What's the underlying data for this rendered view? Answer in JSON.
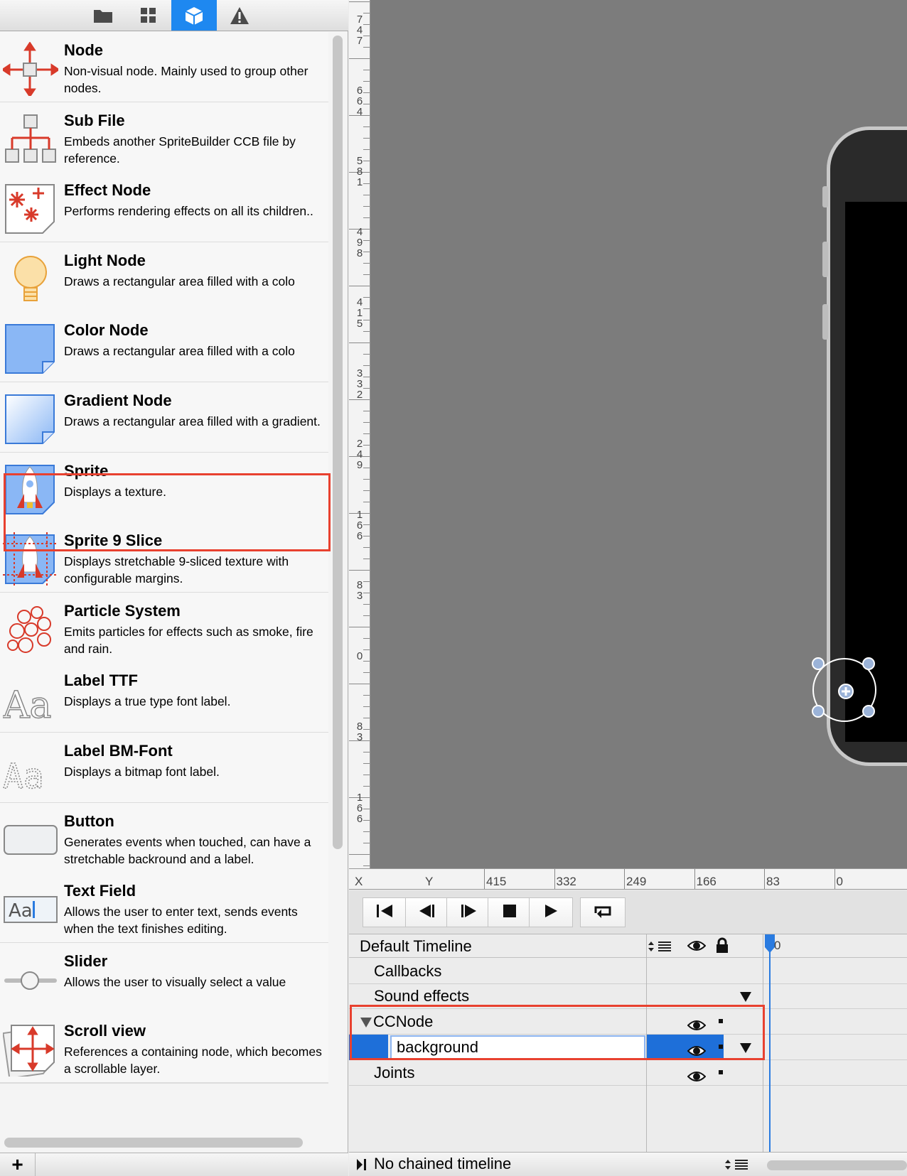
{
  "tabs": [
    {
      "name": "folder-icon",
      "active": false
    },
    {
      "name": "grid-icon",
      "active": false
    },
    {
      "name": "cube-icon",
      "active": true
    },
    {
      "name": "warning-icon",
      "active": false
    }
  ],
  "library": {
    "items": [
      {
        "title": "Node",
        "desc": "Non-visual node. Mainly used to group other nodes.",
        "icon": "node-move-icon"
      },
      {
        "title": "Sub File",
        "desc": "Embeds another SpriteBuilder CCB file by reference.",
        "icon": "sub-file-hierarchy-icon"
      },
      {
        "title": "Effect Node",
        "desc": "Performs rendering effects on all its children..",
        "icon": "effect-sparkle-icon"
      },
      {
        "title": "Light Node",
        "desc": "Draws a rectangular area filled with a colo",
        "icon": "lightbulb-icon"
      },
      {
        "title": "Color Node",
        "desc": "Draws a rectangular area filled with a colo",
        "icon": "color-page-icon"
      },
      {
        "title": "Gradient Node",
        "desc": "Draws a rectangular area filled with a gradient.",
        "icon": "gradient-page-icon"
      },
      {
        "title": "Sprite",
        "desc": "Displays a texture.",
        "icon": "rocket-sprite-icon"
      },
      {
        "title": "Sprite 9 Slice",
        "desc": "Displays stretchable 9-sliced texture with configurable margins.",
        "icon": "rocket-9slice-icon"
      },
      {
        "title": "Particle System",
        "desc": "Emits particles for effects such as smoke, fire and rain.",
        "icon": "particles-icon"
      },
      {
        "title": "Label TTF",
        "desc": "Displays a true type font label.",
        "icon": "label-ttf-icon"
      },
      {
        "title": "Label BM-Font",
        "desc": "Displays a bitmap font label.",
        "icon": "label-bmfont-icon"
      },
      {
        "title": "Button",
        "desc": "Generates events when touched, can have a stretchable backround and a label.",
        "icon": "button-icon"
      },
      {
        "title": "Text Field",
        "desc": "Allows the user to enter text, sends events when the text finishes editing.",
        "icon": "text-field-icon"
      },
      {
        "title": "Slider",
        "desc": "Allows the user to visually select a value",
        "icon": "slider-icon"
      },
      {
        "title": "Scroll view",
        "desc": "References a containing node, which becomes a scrollable layer.",
        "icon": "scroll-view-icon"
      }
    ],
    "add_label": "+"
  },
  "rulers": {
    "vertical": [
      "747",
      "664",
      "581",
      "498",
      "415",
      "332",
      "249",
      "166",
      "83",
      "0",
      "83",
      "166"
    ],
    "horizontal_x": "X",
    "horizontal_y": "Y",
    "horizontal": [
      "415",
      "332",
      "249",
      "166",
      "83",
      "0"
    ]
  },
  "timeline": {
    "name": "Default Timeline",
    "transport": [
      "jump-to-start-icon",
      "step-back-icon",
      "step-forward-icon",
      "stop-icon",
      "play-icon",
      "loop-icon"
    ],
    "ruler_start": "0",
    "rows": [
      {
        "label": "Callbacks",
        "indent": 1
      },
      {
        "label": "Sound effects",
        "indent": 1
      },
      {
        "label": "CCNode",
        "indent": 0
      },
      {
        "label": "background",
        "indent": 2
      },
      {
        "label": "Joints",
        "indent": 1
      }
    ],
    "chain_label": "No chained timeline"
  },
  "colors": {
    "accent": "#1e88f0",
    "highlight": "#e8412f",
    "canvas": "#7c7c7c"
  }
}
